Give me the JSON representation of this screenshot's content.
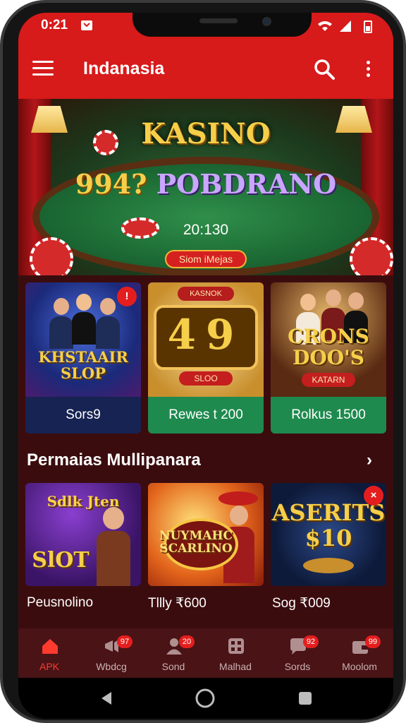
{
  "status_bar": {
    "time": "0:21"
  },
  "app_bar": {
    "title": "Indanasia"
  },
  "banner": {
    "heading": "KASINO",
    "name_number": "994?",
    "name_text": "POBDRANO",
    "timer": "20:130",
    "button_label": "Siom iMejas"
  },
  "featured": [
    {
      "image_text": "KHSTAAIR SLOP",
      "caption": "Sors9",
      "caption_bg": "#172352",
      "badge": "!"
    },
    {
      "image_top": "KASNOK",
      "image_text": "49",
      "image_sub": "SLOO",
      "caption": "Rewes t 200",
      "caption_bg": "#1e8a4e"
    },
    {
      "image_text": "CRONS DOO'S",
      "image_sub": "KATARN",
      "caption": "Rolkus 1500",
      "caption_bg": "#1e8a4e"
    }
  ],
  "section": {
    "title": "Permaias Mullipanara",
    "arrow": "›"
  },
  "games": [
    {
      "image_top": "Sdlk Jten",
      "image_text": "SlOT",
      "caption": "Peusnolino"
    },
    {
      "image_text": "NUYMAHC SCARLINO",
      "caption": "Tllly ₹600"
    },
    {
      "image_text": "ASERITS $10",
      "caption": "Sog ₹009",
      "badge": "×"
    }
  ],
  "bottom_nav": [
    {
      "label": "APK",
      "icon": "home-icon",
      "active": true
    },
    {
      "label": "Wbdcg",
      "icon": "megaphone-icon",
      "badge": "97"
    },
    {
      "label": "Sond",
      "icon": "person-icon",
      "badge": "20"
    },
    {
      "label": "Malhad",
      "icon": "grid-icon"
    },
    {
      "label": "Sords",
      "icon": "chat-icon",
      "badge": "92"
    },
    {
      "label": "Moolom",
      "icon": "wallet-icon",
      "badge": "99"
    }
  ],
  "colors": {
    "brand_red": "#d71a1a",
    "background": "#3b0c0e",
    "nav_bg": "#4a1316",
    "active": "#ff3b30"
  }
}
